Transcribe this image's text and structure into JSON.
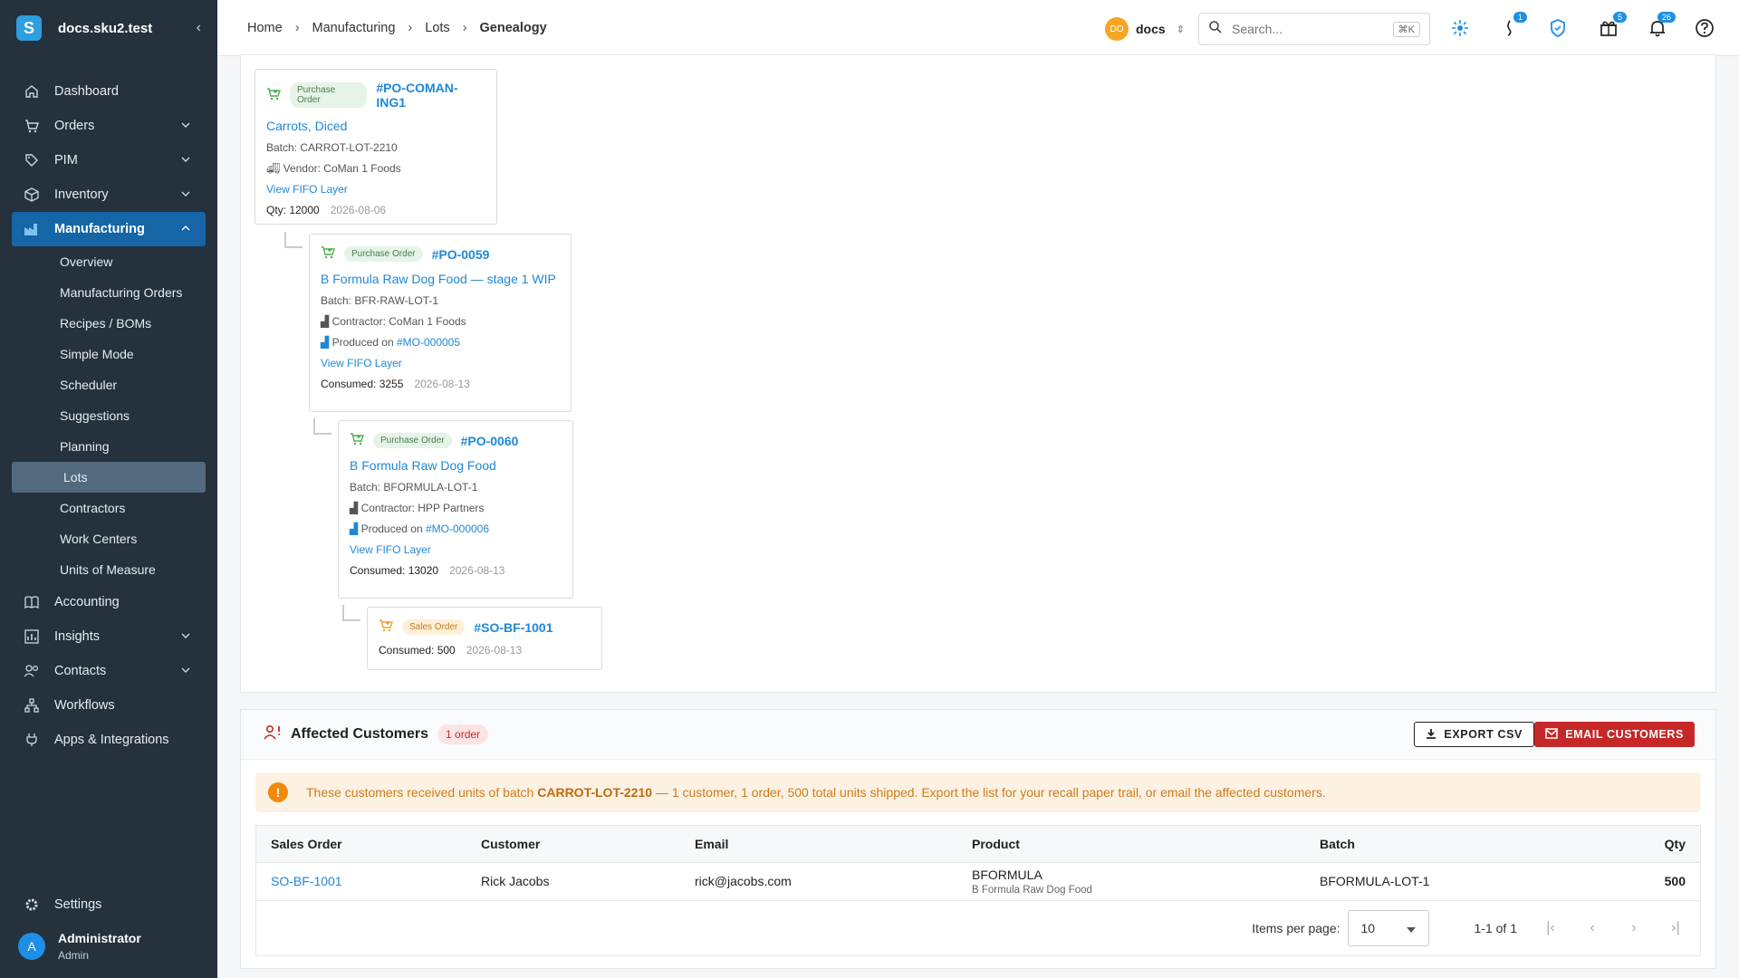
{
  "app": {
    "site": "docs.sku2.test",
    "logo_letter": "S"
  },
  "sidebar": {
    "items": [
      {
        "label": "Dashboard",
        "icon": "home-icon"
      },
      {
        "label": "Orders",
        "icon": "cart-icon"
      },
      {
        "label": "PIM",
        "icon": "tag-icon"
      },
      {
        "label": "Inventory",
        "icon": "box-icon"
      },
      {
        "label": "Manufacturing",
        "icon": "factory-icon"
      }
    ],
    "manufacturing_sub": [
      "Overview",
      "Manufacturing Orders",
      "Recipes / BOMs",
      "Simple Mode",
      "Scheduler",
      "Suggestions",
      "Planning",
      "Lots",
      "Contractors",
      "Work Centers",
      "Units of Measure"
    ],
    "items_after": [
      {
        "label": "Accounting",
        "icon": "book-icon"
      },
      {
        "label": "Insights",
        "icon": "chart-icon"
      },
      {
        "label": "Contacts",
        "icon": "people-icon"
      },
      {
        "label": "Workflows",
        "icon": "workflow-icon"
      },
      {
        "label": "Apps & Integrations",
        "icon": "plug-icon"
      }
    ],
    "settings": "Settings",
    "user": {
      "initial": "A",
      "name": "Administrator",
      "role": "Admin"
    }
  },
  "header": {
    "breadcrumbs": [
      "Home",
      "Manufacturing",
      "Lots",
      "Genealogy"
    ],
    "org_initials": "DO",
    "org_name": "docs",
    "search_placeholder": "Search...",
    "search_shortcut": "⌘K",
    "badges": {
      "whats_new": "1",
      "gifts": "5",
      "notifications": "26"
    }
  },
  "genealogy": {
    "nodes": [
      {
        "type_tag": "Purchase Order",
        "ref": "#PO-COMAN-ING1",
        "title": "Carrots, Diced",
        "batch": "Batch: CARROT-LOT-2210",
        "party": "Vendor: CoMan 1 Foods",
        "view_link": "View FIFO Layer",
        "qty": "Qty: 12000",
        "date": "2026-08-06"
      },
      {
        "type_tag": "Purchase Order",
        "ref": "#PO-0059",
        "title": "B Formula Raw Dog Food — stage 1 WIP",
        "batch": "Batch: BFR-RAW-LOT-1",
        "party": "Contractor: CoMan 1 Foods",
        "produced_label": "Produced on",
        "produced_ref": "#MO-000005",
        "view_link": "View FIFO Layer",
        "qty": "Consumed: 3255",
        "date": "2026-08-13"
      },
      {
        "type_tag": "Purchase Order",
        "ref": "#PO-0060",
        "title": "B Formula Raw Dog Food",
        "batch": "Batch: BFORMULA-LOT-1",
        "party": "Contractor: HPP Partners",
        "produced_label": "Produced on",
        "produced_ref": "#MO-000006",
        "view_link": "View FIFO Layer",
        "qty": "Consumed: 13020",
        "date": "2026-08-13"
      },
      {
        "type_tag": "Sales Order",
        "ref": "#SO-BF-1001",
        "qty": "Consumed: 500",
        "date": "2026-08-13"
      }
    ]
  },
  "affected": {
    "title": "Affected Customers",
    "count": "1 order",
    "export_label": "EXPORT CSV",
    "email_label": "EMAIL CUSTOMERS",
    "alert_prefix": "These customers received units of batch ",
    "alert_batch": "CARROT-LOT-2210",
    "alert_suffix": " — 1 customer, 1 order, 500 total units shipped. Export the list for your recall paper trail, or email the affected customers.",
    "columns": [
      "Sales Order",
      "Customer",
      "Email",
      "Product",
      "Batch",
      "Qty"
    ],
    "rows": [
      {
        "order": "SO-BF-1001",
        "customer": "Rick Jacobs",
        "email": "rick@jacobs.com",
        "product_sku": "BFORMULA",
        "product_name": "B Formula Raw Dog Food",
        "batch": "BFORMULA-LOT-1",
        "qty": "500"
      }
    ],
    "pager": {
      "items_per_page_label": "Items per page:",
      "items_per_page": "10",
      "range": "1-1 of 1"
    }
  }
}
